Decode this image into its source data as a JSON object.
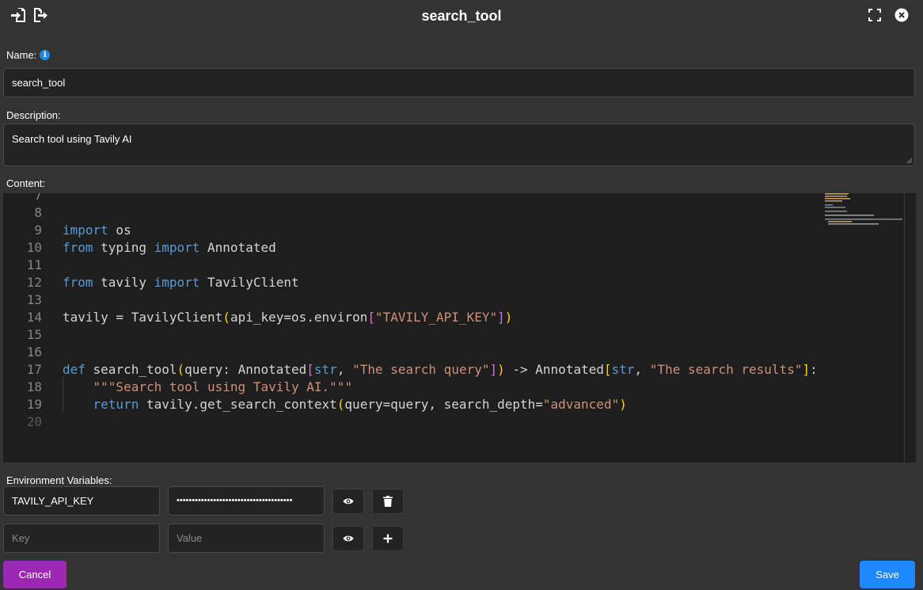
{
  "dialog": {
    "title": "search_tool"
  },
  "form": {
    "name_label": "Name:",
    "name_value": "search_tool",
    "description_label": "Description:",
    "description_value": "Search tool using Tavily AI",
    "content_label": "Content:",
    "env_label": "Environment Variables:"
  },
  "editor": {
    "lines": [
      {
        "n": "7"
      },
      {
        "n": "8"
      },
      {
        "n": "9"
      },
      {
        "n": "10"
      },
      {
        "n": "11"
      },
      {
        "n": "12"
      },
      {
        "n": "13"
      },
      {
        "n": "14"
      },
      {
        "n": "15"
      },
      {
        "n": "16"
      },
      {
        "n": "17"
      },
      {
        "n": "18"
      },
      {
        "n": "19"
      },
      {
        "n": "20"
      }
    ],
    "tokens": {
      "l9_kw": "import",
      "l9_rest": " os",
      "l10_kw1": "from",
      "l10_mod": " typing ",
      "l10_kw2": "import",
      "l10_rest": " Annotated",
      "l12_kw1": "from",
      "l12_mod": " tavily ",
      "l12_kw2": "import",
      "l12_rest": " TavilyClient",
      "l14_a": "tavily = TavilyClient",
      "l14_p1": "(",
      "l14_b": "api_key=os.environ",
      "l14_p2": "[",
      "l14_str": "\"TAVILY_API_KEY\"",
      "l14_p3": "]",
      "l14_p4": ")",
      "l17_kw": "def",
      "l17_a": " search_tool",
      "l17_p1": "(",
      "l17_b": "query: Annotated",
      "l17_p2": "[",
      "l17_t1": "str",
      "l17_c1": ", ",
      "l17_s1": "\"The search query\"",
      "l17_p3": "]",
      "l17_p4": ")",
      "l17_c": " -> Annotated",
      "l17_p5": "[",
      "l17_t2": "str",
      "l17_c2": ", ",
      "l17_s2": "\"The search results\"",
      "l17_p6": "]",
      "l17_end": ":",
      "l18_doc": "\"\"\"Search tool using Tavily AI.\"\"\"",
      "l19_kw": "return",
      "l19_a": " tavily.get_search_context",
      "l19_p1": "(",
      "l19_b": "query=query, search_depth=",
      "l19_s": "\"advanced\"",
      "l19_p2": ")"
    }
  },
  "env_vars": {
    "rows": [
      {
        "key": "TAVILY_API_KEY",
        "value_masked": "••••••••••••••••••••••••••••••••••••••"
      }
    ],
    "new_key_placeholder": "Key",
    "new_value_placeholder": "Value"
  },
  "actions": {
    "cancel_label": "Cancel",
    "save_label": "Save"
  },
  "colors": {
    "background": "#333333",
    "cancel": "#9c27b0",
    "save": "#1e88ff",
    "info": "#1e88e5"
  }
}
